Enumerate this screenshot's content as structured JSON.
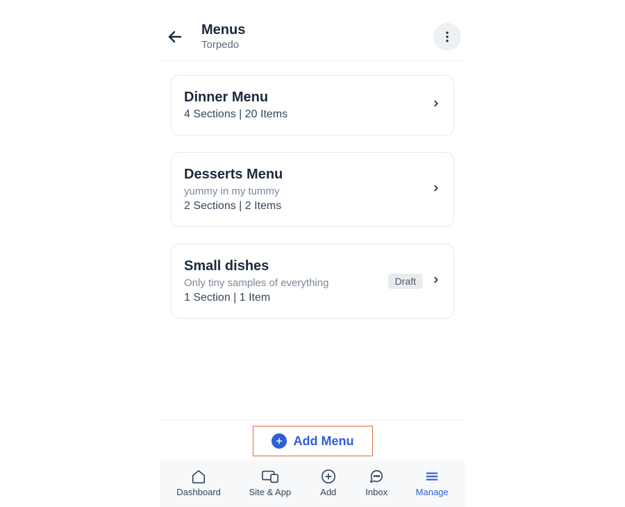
{
  "header": {
    "title": "Menus",
    "subtitle": "Torpedo"
  },
  "menus": [
    {
      "title": "Dinner Menu",
      "description": "",
      "meta": "4 Sections | 20 Items",
      "draft_label": ""
    },
    {
      "title": "Desserts Menu",
      "description": "yummy in my tummy",
      "meta": "2 Sections | 2 Items",
      "draft_label": ""
    },
    {
      "title": "Small dishes",
      "description": "Only tiny samples of everything",
      "meta": "1 Section | 1 Item",
      "draft_label": "Draft"
    }
  ],
  "add_menu_label": "Add Menu",
  "tabs": [
    {
      "label": "Dashboard"
    },
    {
      "label": "Site & App"
    },
    {
      "label": "Add"
    },
    {
      "label": "Inbox"
    },
    {
      "label": "Manage"
    }
  ]
}
